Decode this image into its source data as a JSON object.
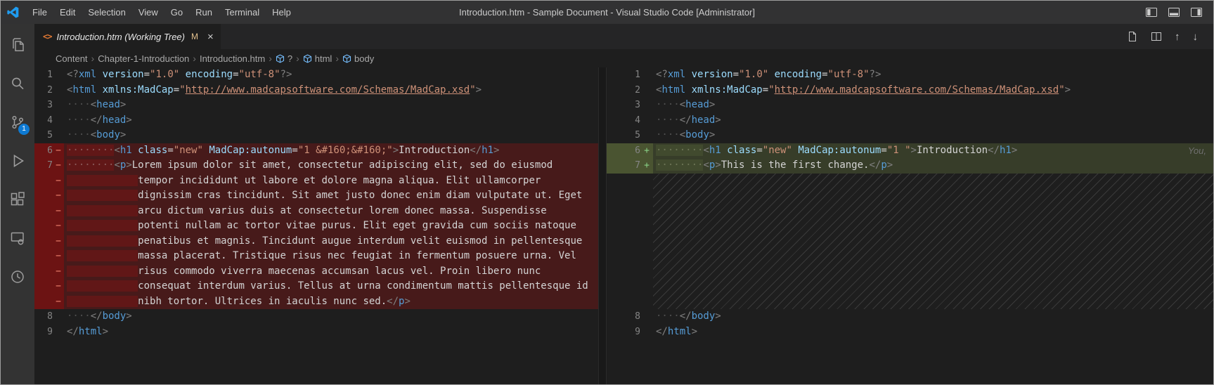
{
  "title_bar": {
    "title": "Introduction.htm - Sample Document - Visual Studio Code [Administrator]",
    "menus": [
      "File",
      "Edit",
      "Selection",
      "View",
      "Go",
      "Run",
      "Terminal",
      "Help"
    ]
  },
  "activity_bar": {
    "items": [
      "explorer",
      "search",
      "source-control",
      "run-and-debug",
      "extensions",
      "live-preview",
      "history"
    ],
    "source_control_badge": "1"
  },
  "tab": {
    "file_icon": "<>",
    "label": "Introduction.htm (Working Tree)",
    "modified": "M",
    "close": "×"
  },
  "editor_actions": {
    "previous": "↑",
    "next": "↓"
  },
  "breadcrumbs": [
    {
      "label": "Content",
      "icon": false
    },
    {
      "label": "Chapter-1-Introduction",
      "icon": false
    },
    {
      "label": "Introduction.htm",
      "icon": false
    },
    {
      "label": "?",
      "icon": true
    },
    {
      "label": "html",
      "icon": true
    },
    {
      "label": "body",
      "icon": true
    }
  ],
  "diff": {
    "left": {
      "lines": [
        {
          "n": "1",
          "t": "norm",
          "seg": [
            [
              "p",
              "<?"
            ],
            [
              "tag",
              "xml"
            ],
            [
              "d",
              " "
            ],
            [
              "attr",
              "version"
            ],
            [
              "d",
              "="
            ],
            [
              "str",
              "\"1.0\""
            ],
            [
              "d",
              " "
            ],
            [
              "attr",
              "encoding"
            ],
            [
              "d",
              "="
            ],
            [
              "str",
              "\"utf-8\""
            ],
            [
              "p",
              "?>"
            ]
          ]
        },
        {
          "n": "2",
          "t": "norm",
          "seg": [
            [
              "p",
              "<"
            ],
            [
              "tag",
              "html"
            ],
            [
              "d",
              " "
            ],
            [
              "attr",
              "xmlns:MadCap"
            ],
            [
              "d",
              "="
            ],
            [
              "str",
              "\""
            ],
            [
              "link",
              "http://www.madcapsoftware.com/Schemas/MadCap.xsd"
            ],
            [
              "str",
              "\""
            ],
            [
              "p",
              ">"
            ]
          ]
        },
        {
          "n": "3",
          "t": "norm",
          "seg": [
            [
              "ws",
              "····"
            ],
            [
              "p",
              "<"
            ],
            [
              "tag",
              "head"
            ],
            [
              "p",
              ">"
            ]
          ]
        },
        {
          "n": "4",
          "t": "norm",
          "seg": [
            [
              "ws",
              "····"
            ],
            [
              "p",
              "</"
            ],
            [
              "tag",
              "head"
            ],
            [
              "p",
              ">"
            ]
          ]
        },
        {
          "n": "5",
          "t": "norm",
          "seg": [
            [
              "ws",
              "····"
            ],
            [
              "p",
              "<"
            ],
            [
              "tag",
              "body"
            ],
            [
              "p",
              ">"
            ]
          ]
        },
        {
          "n": "6",
          "mk": "−",
          "t": "rem",
          "seg": [
            [
              "ws",
              "········"
            ],
            [
              "p",
              "<"
            ],
            [
              "tag",
              "h1"
            ],
            [
              "d",
              " "
            ],
            [
              "attr",
              "class"
            ],
            [
              "d",
              "="
            ],
            [
              "str",
              "\"new\""
            ],
            [
              "d",
              " "
            ],
            [
              "attr",
              "MadCap:autonum"
            ],
            [
              "d",
              "="
            ],
            [
              "str",
              "\"1 "
            ],
            [
              "ent",
              "&#160;&#160;"
            ],
            [
              "str",
              "\""
            ],
            [
              "p",
              ">"
            ],
            [
              "d",
              "Introduction"
            ],
            [
              "p",
              "</"
            ],
            [
              "tag",
              "h1"
            ],
            [
              "p",
              ">"
            ]
          ]
        },
        {
          "n": "7",
          "mk": "−",
          "t": "rem",
          "seg": [
            [
              "ws",
              "········"
            ],
            [
              "p",
              "<"
            ],
            [
              "tag",
              "p"
            ],
            [
              "p",
              ">"
            ],
            [
              "d",
              "Lorem ipsum dolor sit amet, consectetur adipiscing elit, sed do eiusmod"
            ]
          ]
        },
        {
          "mk": "−",
          "t": "rem",
          "seg": [
            [
              "wrap",
              "            "
            ],
            [
              "d",
              "tempor incididunt ut labore et dolore magna aliqua. Elit ullamcorper"
            ]
          ]
        },
        {
          "mk": "−",
          "t": "rem",
          "seg": [
            [
              "wrap",
              "            "
            ],
            [
              "d",
              "dignissim cras tincidunt. Sit amet justo donec enim diam vulputate ut. Eget"
            ]
          ]
        },
        {
          "mk": "−",
          "t": "rem",
          "seg": [
            [
              "wrap",
              "            "
            ],
            [
              "d",
              "arcu dictum varius duis at consectetur lorem donec massa. Suspendisse"
            ]
          ]
        },
        {
          "mk": "−",
          "t": "rem",
          "seg": [
            [
              "wrap",
              "            "
            ],
            [
              "d",
              "potenti nullam ac tortor vitae purus. Elit eget gravida cum sociis natoque"
            ]
          ]
        },
        {
          "mk": "−",
          "t": "rem",
          "seg": [
            [
              "wrap",
              "            "
            ],
            [
              "d",
              "penatibus et magnis. Tincidunt augue interdum velit euismod in pellentesque"
            ]
          ]
        },
        {
          "mk": "−",
          "t": "rem",
          "seg": [
            [
              "wrap",
              "            "
            ],
            [
              "d",
              "massa placerat. Tristique risus nec feugiat in fermentum posuere urna. Vel"
            ]
          ]
        },
        {
          "mk": "−",
          "t": "rem",
          "seg": [
            [
              "wrap",
              "            "
            ],
            [
              "d",
              "risus commodo viverra maecenas accumsan lacus vel. Proin libero nunc"
            ]
          ]
        },
        {
          "mk": "−",
          "t": "rem",
          "seg": [
            [
              "wrap",
              "            "
            ],
            [
              "d",
              "consequat interdum varius. Tellus at urna condimentum mattis pellentesque id"
            ]
          ]
        },
        {
          "mk": "−",
          "t": "rem",
          "seg": [
            [
              "wrap",
              "            "
            ],
            [
              "d",
              "nibh tortor. Ultrices in iaculis nunc sed."
            ],
            [
              "p",
              "</"
            ],
            [
              "tag",
              "p"
            ],
            [
              "p",
              ">"
            ]
          ]
        },
        {
          "n": "8",
          "t": "norm",
          "seg": [
            [
              "ws",
              "····"
            ],
            [
              "p",
              "</"
            ],
            [
              "tag",
              "body"
            ],
            [
              "p",
              ">"
            ]
          ]
        },
        {
          "n": "9",
          "t": "norm",
          "seg": [
            [
              "p",
              "</"
            ],
            [
              "tag",
              "html"
            ],
            [
              "p",
              ">"
            ]
          ]
        }
      ]
    },
    "right": {
      "lines": [
        {
          "n": "1",
          "t": "norm",
          "seg": [
            [
              "p",
              "<?"
            ],
            [
              "tag",
              "xml"
            ],
            [
              "d",
              " "
            ],
            [
              "attr",
              "version"
            ],
            [
              "d",
              "="
            ],
            [
              "str",
              "\"1.0\""
            ],
            [
              "d",
              " "
            ],
            [
              "attr",
              "encoding"
            ],
            [
              "d",
              "="
            ],
            [
              "str",
              "\"utf-8\""
            ],
            [
              "p",
              "?>"
            ]
          ]
        },
        {
          "n": "2",
          "t": "norm",
          "seg": [
            [
              "p",
              "<"
            ],
            [
              "tag",
              "html"
            ],
            [
              "d",
              " "
            ],
            [
              "attr",
              "xmlns:MadCap"
            ],
            [
              "d",
              "="
            ],
            [
              "str",
              "\""
            ],
            [
              "link",
              "http://www.madcapsoftware.com/Schemas/MadCap.xsd"
            ],
            [
              "str",
              "\""
            ],
            [
              "p",
              ">"
            ]
          ]
        },
        {
          "n": "3",
          "t": "norm",
          "seg": [
            [
              "ws",
              "····"
            ],
            [
              "p",
              "<"
            ],
            [
              "tag",
              "head"
            ],
            [
              "p",
              ">"
            ]
          ]
        },
        {
          "n": "4",
          "t": "norm",
          "seg": [
            [
              "ws",
              "····"
            ],
            [
              "p",
              "</"
            ],
            [
              "tag",
              "head"
            ],
            [
              "p",
              ">"
            ]
          ]
        },
        {
          "n": "5",
          "t": "norm",
          "seg": [
            [
              "ws",
              "····"
            ],
            [
              "p",
              "<"
            ],
            [
              "tag",
              "body"
            ],
            [
              "p",
              ">"
            ]
          ]
        },
        {
          "n": "6",
          "mk": "+",
          "t": "add",
          "trail": "You,",
          "seg": [
            [
              "ws",
              "········"
            ],
            [
              "p",
              "<"
            ],
            [
              "tag",
              "h1"
            ],
            [
              "d",
              " "
            ],
            [
              "attr",
              "class"
            ],
            [
              "d",
              "="
            ],
            [
              "str",
              "\"new\""
            ],
            [
              "d",
              " "
            ],
            [
              "attr",
              "MadCap:autonum"
            ],
            [
              "d",
              "="
            ],
            [
              "str",
              "\"1 \""
            ],
            [
              "p",
              ">"
            ],
            [
              "d",
              "Introduction"
            ],
            [
              "p",
              "</"
            ],
            [
              "tag",
              "h1"
            ],
            [
              "p",
              ">"
            ]
          ]
        },
        {
          "n": "7",
          "mk": "+",
          "t": "add",
          "seg": [
            [
              "ws",
              "········"
            ],
            [
              "p",
              "<"
            ],
            [
              "tag",
              "p"
            ],
            [
              "p",
              ">"
            ],
            [
              "d",
              "This is the first change."
            ],
            [
              "p",
              "</"
            ],
            [
              "tag",
              "p"
            ],
            [
              "p",
              ">"
            ]
          ]
        },
        {
          "t": "hatch",
          "rows": 9
        },
        {
          "n": "8",
          "t": "norm",
          "seg": [
            [
              "ws",
              "····"
            ],
            [
              "p",
              "</"
            ],
            [
              "tag",
              "body"
            ],
            [
              "p",
              ">"
            ]
          ]
        },
        {
          "n": "9",
          "t": "norm",
          "seg": [
            [
              "p",
              "</"
            ],
            [
              "tag",
              "html"
            ],
            [
              "p",
              ">"
            ]
          ]
        }
      ]
    }
  }
}
